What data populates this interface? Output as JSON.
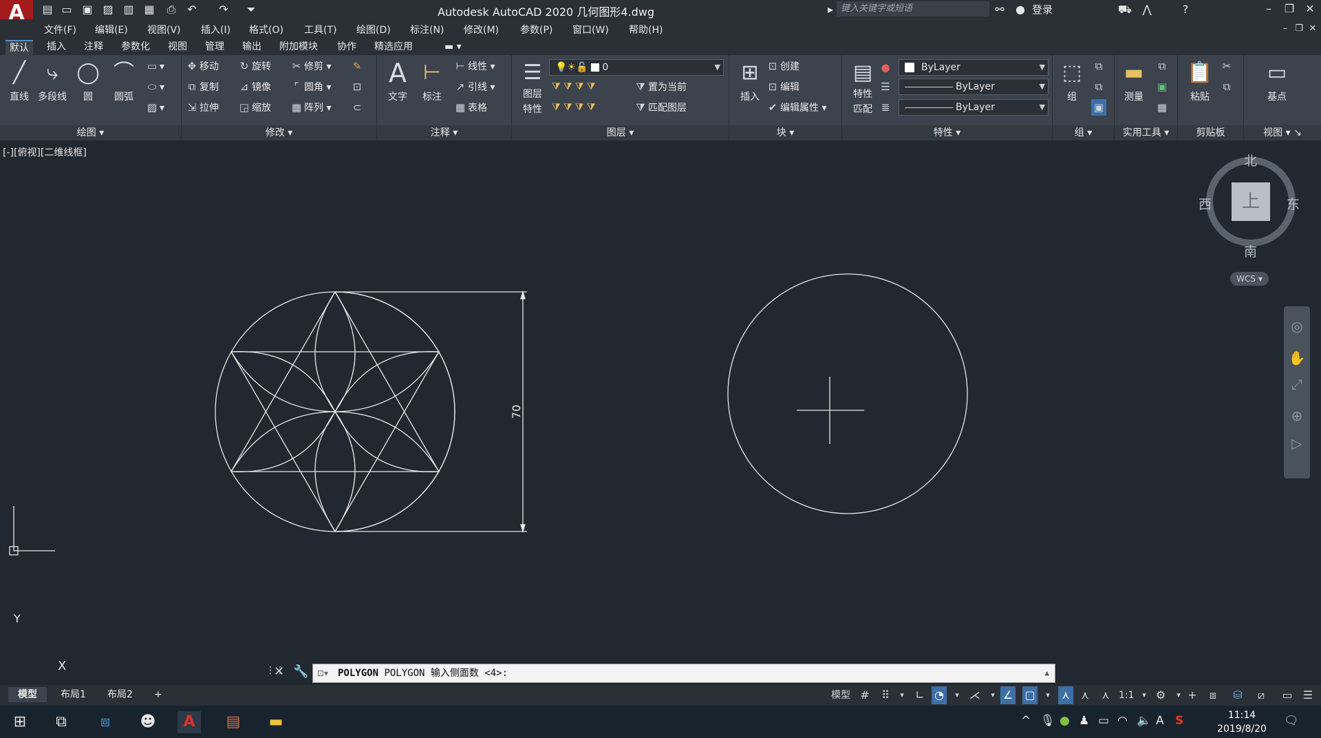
{
  "app": {
    "logo_text": "A",
    "title": "Autodesk AutoCAD 2020    几何图形4.dwg",
    "search_placeholder": "键入关键字或短语",
    "signin_label": "登录",
    "accent_color": "#3d6fa6",
    "logo_color": "#a41b1b"
  },
  "menu": [
    "文件(F)",
    "编辑(E)",
    "视图(V)",
    "插入(I)",
    "格式(O)",
    "工具(T)",
    "绘图(D)",
    "标注(N)",
    "修改(M)",
    "参数(P)",
    "窗口(W)",
    "帮助(H)"
  ],
  "ribbon_tabs": [
    "默认",
    "插入",
    "注释",
    "参数化",
    "视图",
    "管理",
    "输出",
    "附加模块",
    "协作",
    "精选应用"
  ],
  "ribbon": {
    "draw": {
      "title": "绘图",
      "line": "直线",
      "polyline": "多段线",
      "circle": "圆",
      "arc": "圆弧"
    },
    "modify": {
      "title": "修改",
      "move": "移动",
      "rotate": "旋转",
      "trim": "修剪",
      "copy": "复制",
      "mirror": "镜像",
      "fillet": "圆角",
      "stretch": "拉伸",
      "scale": "缩放",
      "array": "阵列"
    },
    "annotation": {
      "title": "注释",
      "text": "文字",
      "dimension": "标注",
      "linear": "线性",
      "leader": "引线",
      "table": "表格"
    },
    "layers": {
      "title": "图层",
      "layer_props_1": "图层",
      "layer_props_2": "特性",
      "current_layer": "0",
      "set_current": "置为当前",
      "match_layer": "匹配图层"
    },
    "block": {
      "title": "块",
      "insert": "插入",
      "create": "创建",
      "edit": "编辑",
      "edit_attr": "编辑属性"
    },
    "properties": {
      "title": "特性",
      "match_1": "特性",
      "match_2": "匹配",
      "color": "ByLayer",
      "linetype": "ByLayer",
      "lineweight": "ByLayer"
    },
    "groups": {
      "title": "组",
      "group": "组"
    },
    "utilities": {
      "title": "实用工具",
      "measure": "测量"
    },
    "clipboard": {
      "title": "剪贴板",
      "paste": "粘贴"
    },
    "view": {
      "title": "视图",
      "base": "基点"
    }
  },
  "viewport": {
    "label": "[-][俯视][二维线框]",
    "dimension_text": "70",
    "ucs_y": "Y",
    "ucs_x": "X"
  },
  "viewcube": {
    "north": "北",
    "south": "南",
    "east": "东",
    "west": "西",
    "face": "上",
    "wcs": "WCS"
  },
  "command": {
    "name": "POLYGON",
    "prompt": "POLYGON 输入侧面数 <4>:"
  },
  "layout_tabs": [
    "模型",
    "布局1",
    "布局2",
    "+"
  ],
  "status": {
    "model": "模型",
    "scale": "1:1"
  },
  "taskbar": {
    "time": "11:14",
    "date": "2019/8/20"
  }
}
